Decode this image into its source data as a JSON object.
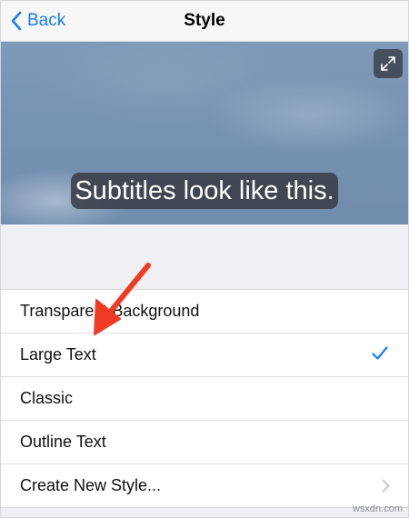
{
  "navbar": {
    "back_label": "Back",
    "title": "Style"
  },
  "preview": {
    "subtitle_text": "Subtitles look like this."
  },
  "styles": {
    "items": [
      {
        "label": "Transparent Background",
        "selected": false
      },
      {
        "label": "Large Text",
        "selected": true
      },
      {
        "label": "Classic",
        "selected": false
      },
      {
        "label": "Outline Text",
        "selected": false
      },
      {
        "label": "Create New Style...",
        "selected": false,
        "disclosure": true
      }
    ]
  },
  "colors": {
    "accent": "#1a7cf6",
    "annotation_arrow": "#ef3b24"
  },
  "icons": {
    "back": "chevron-left-icon",
    "expand": "expand-icon",
    "selected": "checkmark-icon",
    "disclosure": "chevron-right-icon"
  },
  "watermark": "wsxdn.com"
}
